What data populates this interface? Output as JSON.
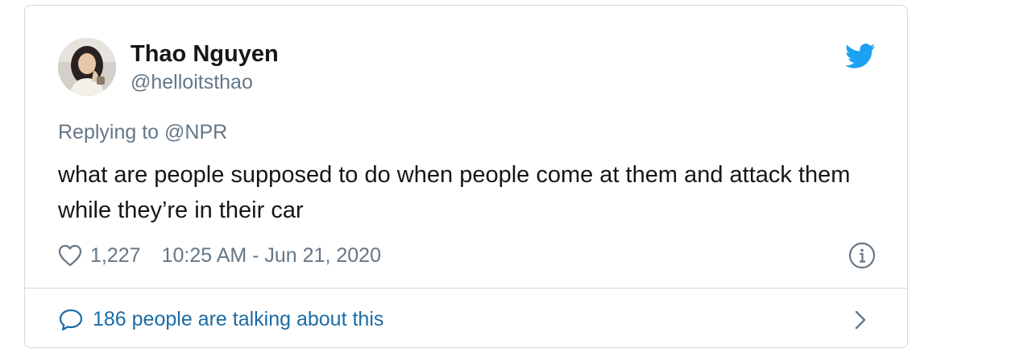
{
  "tweet": {
    "author_name": "Thao Nguyen",
    "author_handle": "@helloitsthao",
    "replying_prefix": "Replying to",
    "replying_to": "@NPR",
    "text": "what are people supposed to do when people come at them and attack them while they’re in their car",
    "like_count": "1,227",
    "timestamp": "10:25 AM - Jun 21, 2020",
    "talking_text": "186 people are talking about this"
  },
  "icons": {
    "platform": "twitter-bird-icon",
    "like": "heart-icon",
    "info": "info-icon",
    "conversation": "speech-bubble-icon",
    "expand": "chevron-right-icon"
  },
  "colors": {
    "brand_blue": "#1da1f2",
    "link_blue": "#1b6ba6",
    "secondary_text": "#657786",
    "primary_text": "#14171a",
    "border": "#cfd9de"
  }
}
